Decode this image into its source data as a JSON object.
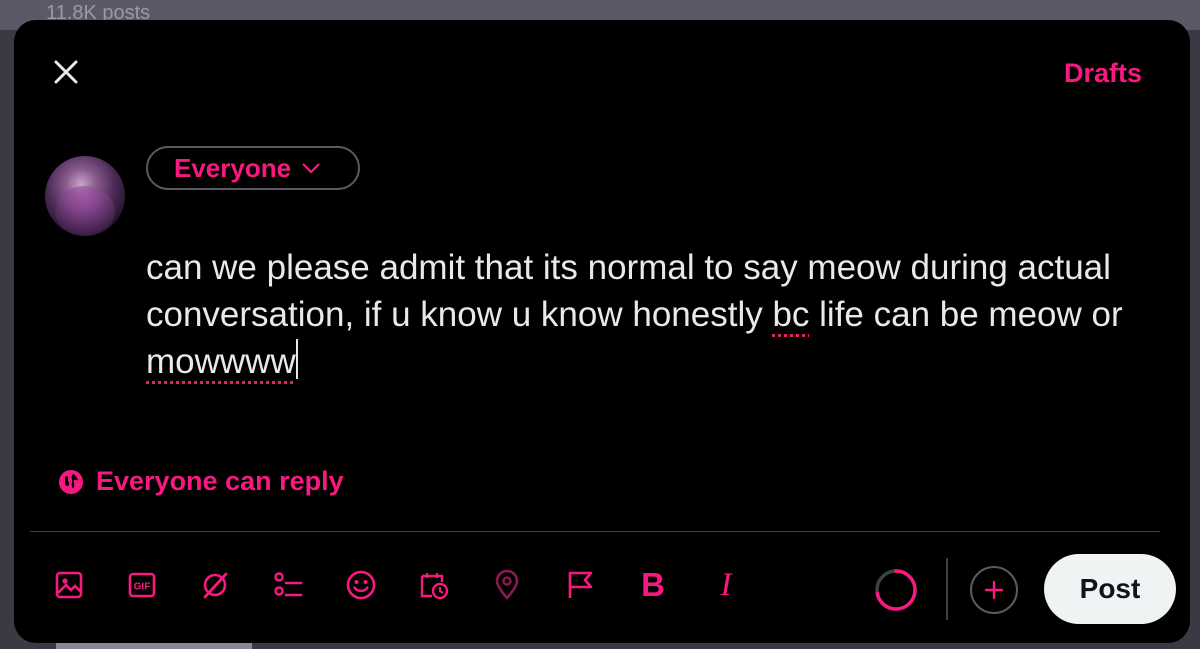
{
  "background": {
    "posts_count": "11.8K posts"
  },
  "header": {
    "close_icon": "close-icon",
    "drafts_label": "Drafts"
  },
  "composer": {
    "audience_label": "Everyone",
    "text_parts": {
      "part1": "can we please admit that its normal to say meow during actual conversation, if u know u know honestly ",
      "misspelled1": "bc",
      "part2": " life can be meow or ",
      "misspelled2": "mowwww"
    },
    "reply_setting_label": "Everyone can reply"
  },
  "toolbar": {
    "icons": [
      "media-icon",
      "gif-icon",
      "grok-icon",
      "poll-icon",
      "emoji-icon",
      "schedule-icon",
      "location-icon",
      "flag-icon",
      "bold-icon",
      "italic-icon"
    ],
    "bold_label": "B",
    "italic_label": "I",
    "gif_label": "GIF",
    "progress": 0.72,
    "post_label": "Post"
  },
  "colors": {
    "accent": "#f91880",
    "text": "#e7e9ea",
    "modal_bg": "#000000",
    "post_bg": "#eff3f4"
  }
}
